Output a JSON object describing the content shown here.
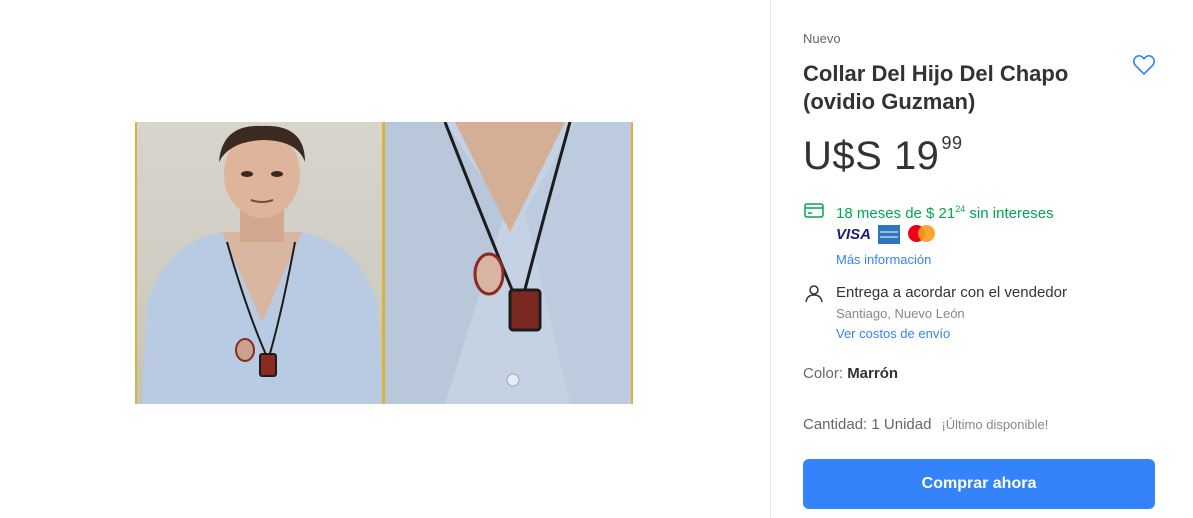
{
  "product": {
    "condition": "Nuevo",
    "title": "Collar Del Hijo Del Chapo (ovidio Guzman)",
    "price": {
      "currency": "U$S",
      "integer": "19",
      "cents": "99"
    }
  },
  "payment": {
    "installments_prefix": "18 meses de $ 21",
    "installments_cents": "24",
    "installments_suffix": " sin intereses",
    "cards": [
      "visa",
      "amex",
      "mastercard"
    ],
    "visa_label": "VISA",
    "more_info": "Más información",
    "accent_color": "#00a650"
  },
  "shipping": {
    "method": "Entrega a acordar con el vendedor",
    "location": "Santiago, Nuevo León",
    "costs_link": "Ver costos de envío"
  },
  "attributes": {
    "color_label": "Color: ",
    "color_value": "Marrón"
  },
  "quantity": {
    "label": "Cantidad: 1 Unidad",
    "availability": "¡Último disponible!"
  },
  "actions": {
    "buy_now": "Comprar ahora",
    "buy_color": "#3483fa"
  },
  "icons": {
    "favorite": "heart-icon",
    "card": "credit-card-icon",
    "user": "person-icon"
  }
}
